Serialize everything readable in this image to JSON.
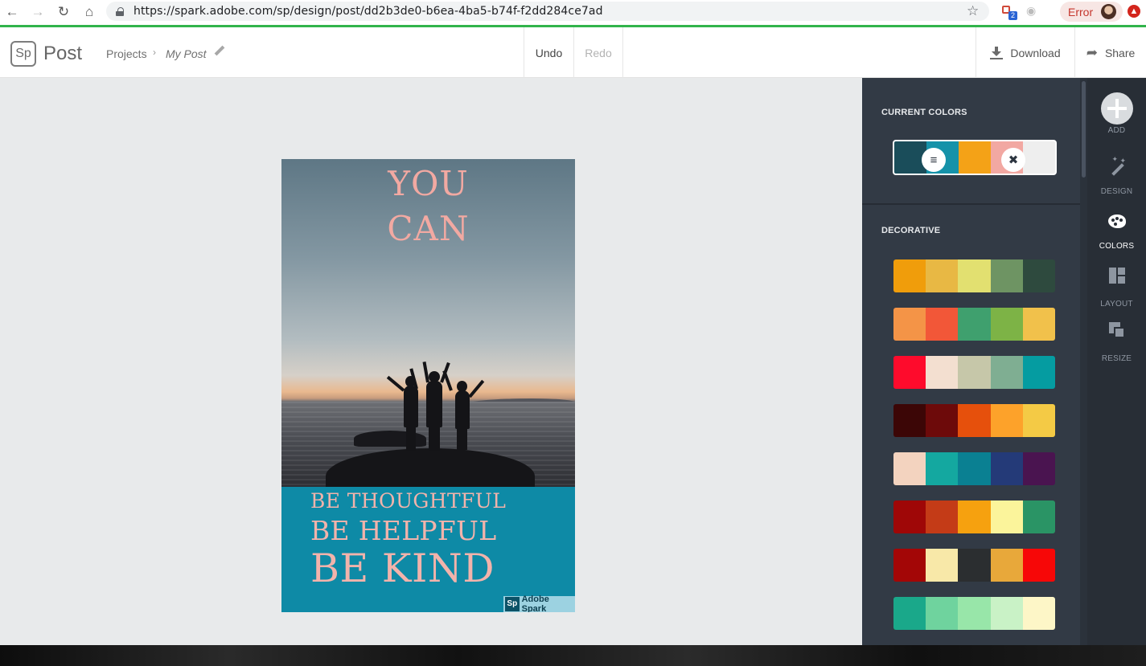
{
  "browser": {
    "url_host": "https://spark.adobe.com",
    "url_path": "/sp/design/post/dd2b3de0-b6ea-4ba5-b74f-f2dd284ce7ad",
    "error_label": "Error",
    "ext_badge_count": "2"
  },
  "header": {
    "logo": "Sp",
    "app_name": "Post",
    "breadcrumb_projects": "Projects",
    "breadcrumb_current": "My Post",
    "undo": "Undo",
    "redo": "Redo",
    "download": "Download",
    "share": "Share"
  },
  "poster": {
    "line1": "YOU",
    "line2": "CAN",
    "line3": "BE THOUGHTFUL",
    "line4": "BE HELPFUL",
    "line5": "BE KIND",
    "badge_logo": "Sp",
    "badge_text": "Adobe Spark"
  },
  "colors_panel": {
    "current_title": "CURRENT COLORS",
    "decorative_title": "DECORATIVE",
    "current_palette": [
      "#1a4d5a",
      "#1592a9",
      "#f4a217",
      "#f2a8a2",
      "#eeeeee"
    ],
    "decorative_palettes": [
      [
        "#f09d0b",
        "#e8b844",
        "#e2e070",
        "#6e9463",
        "#2e4a3e"
      ],
      [
        "#f49447",
        "#f25738",
        "#3fa06e",
        "#7db346",
        "#f1c14b"
      ],
      [
        "#fe0b2c",
        "#f3dfd0",
        "#c6c7a9",
        "#7fae92",
        "#059ca1"
      ],
      [
        "#3c0606",
        "#6d0a0a",
        "#e6500c",
        "#fda22a",
        "#f4ca45"
      ],
      [
        "#f3d3bf",
        "#14a8a0",
        "#0a8092",
        "#243a78",
        "#4a1450"
      ],
      [
        "#9f0707",
        "#c43b17",
        "#f6a10f",
        "#fbf49b",
        "#2a9465"
      ],
      [
        "#a30606",
        "#f8e8a8",
        "#2b2e30",
        "#e8a83a",
        "#f70707"
      ],
      [
        "#1aa88a",
        "#6fd39e",
        "#98e6a9",
        "#c9f2c6",
        "#fdf6c7"
      ]
    ]
  },
  "rail": {
    "add": "ADD",
    "design": "DESIGN",
    "colors": "COLORS",
    "layout": "LAYOUT",
    "resize": "RESIZE"
  }
}
